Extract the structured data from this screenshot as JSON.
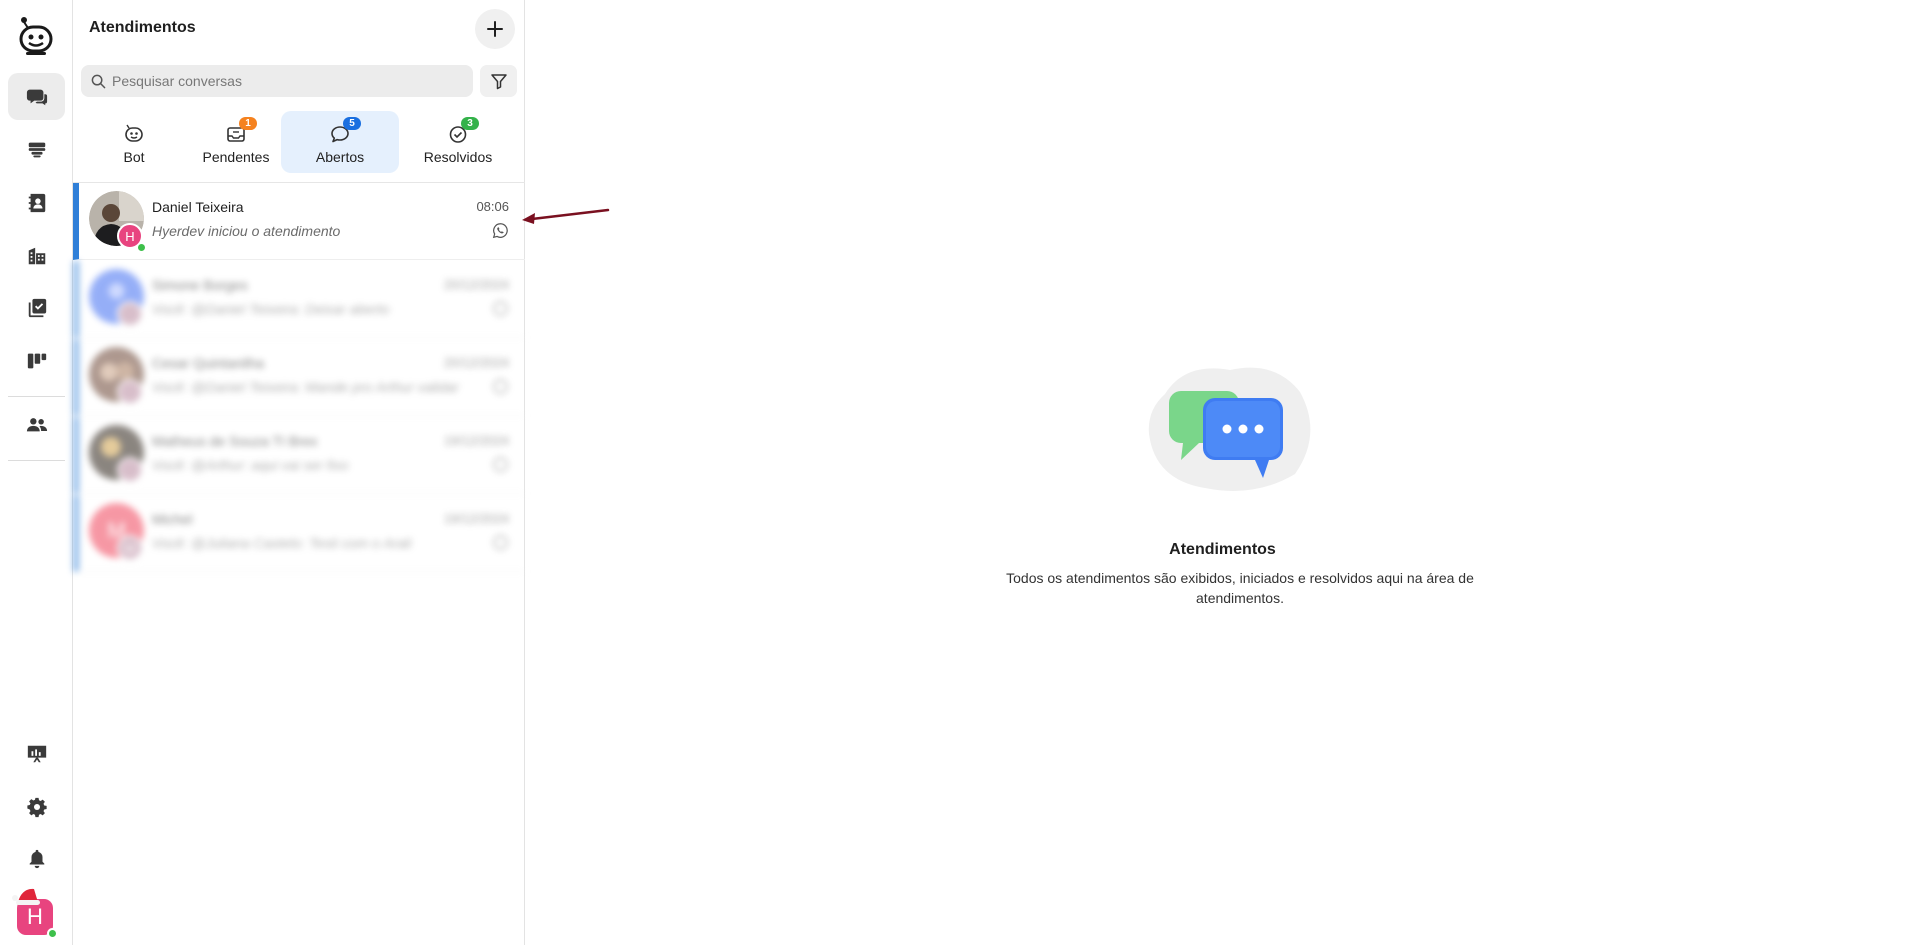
{
  "panel": {
    "title": "Atendimentos",
    "search_placeholder": "Pesquisar conversas"
  },
  "tabs": [
    {
      "label": "Bot",
      "badge": null,
      "icon": "bot-icon"
    },
    {
      "label": "Pendentes",
      "badge": "1",
      "badge_color": "#f5821f",
      "icon": "inbox-icon"
    },
    {
      "label": "Abertos",
      "badge": "5",
      "badge_color": "#1a6fe0",
      "icon": "chat-bubble-icon",
      "active": true
    },
    {
      "label": "Resolvidos",
      "badge": "3",
      "badge_color": "#34b24a",
      "icon": "check-circle-icon"
    }
  ],
  "conversations": [
    {
      "name": "Daniel Teixeira",
      "time": "08:06",
      "message": "Hyerdev iniciou o atendimento",
      "agent_initial": "H",
      "channel": "whatsapp-icon",
      "blurred": false
    },
    {
      "name": "Simone Borges",
      "time": "20/12/2024",
      "message": "Você: @Daniel Teixeira: Deixar aberto",
      "agent_initial": "",
      "channel": "whatsapp-icon",
      "blurred": true
    },
    {
      "name": "Cesar Quintanilha",
      "time": "20/12/2024",
      "message": "Você: @Daniel Teixeira: Mande pro Arthur validar",
      "agent_initial": "",
      "channel": "whatsapp-icon",
      "blurred": true
    },
    {
      "name": "Matheus de Souza TI Brex",
      "time": "19/12/2024",
      "message": "Você: @Arthur: aqui vai ser fixo",
      "agent_initial": "",
      "channel": "whatsapp-icon",
      "blurred": true
    },
    {
      "name": "Michel",
      "time": "19/12/2024",
      "message": "Você: @Juliana Castelo: Testi com o Arali",
      "agent_initial": "M",
      "channel": "whatsapp-icon",
      "blurred": true
    }
  ],
  "empty_state": {
    "title": "Atendimentos",
    "description": "Todos os atendimentos são exibidos, iniciados e resolvidos aqui na área de atendimentos."
  },
  "user": {
    "initial": "H"
  },
  "colors": {
    "accent": "#2f7fd8",
    "active_tab_bg": "#e5f0fd",
    "arrow": "#7a1020"
  }
}
